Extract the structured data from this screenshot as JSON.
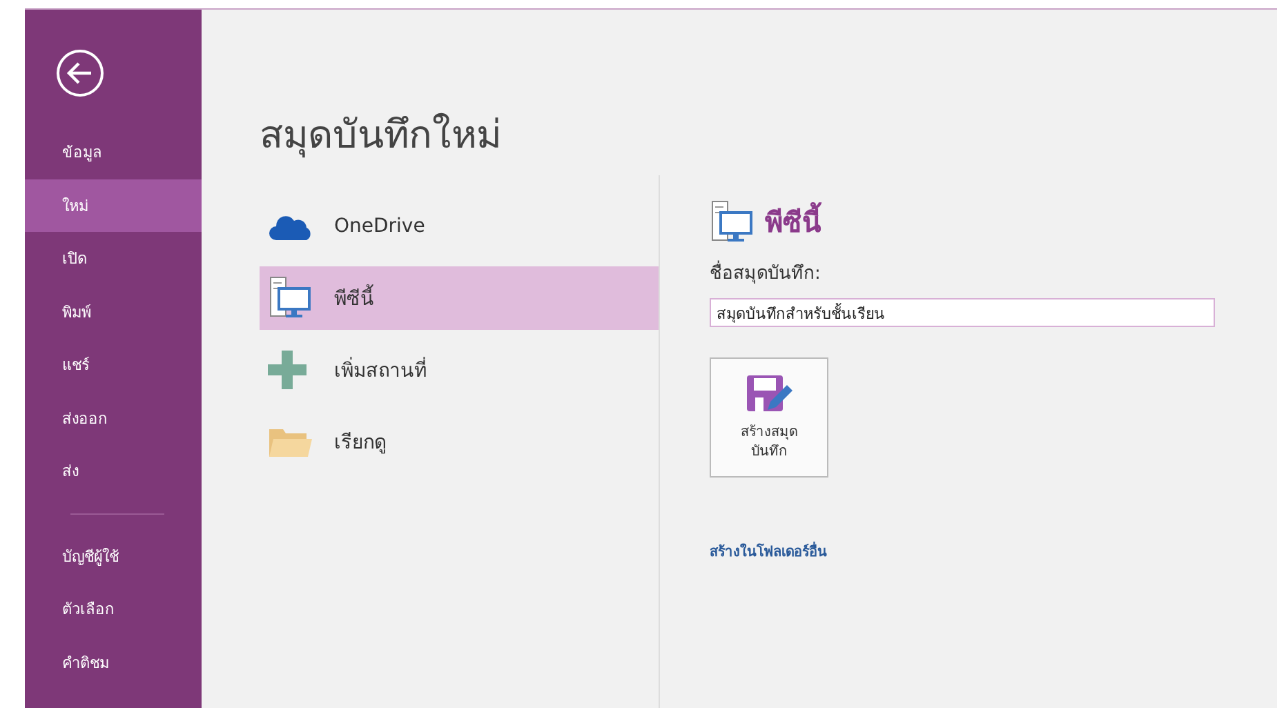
{
  "sidebar": {
    "items": [
      {
        "label": "ข้อมูล",
        "selected": false
      },
      {
        "label": "ใหม่",
        "selected": true
      },
      {
        "label": "เปิด",
        "selected": false
      },
      {
        "label": "พิมพ์",
        "selected": false
      },
      {
        "label": "แชร์",
        "selected": false
      },
      {
        "label": "ส่งออก",
        "selected": false
      },
      {
        "label": "ส่ง",
        "selected": false
      }
    ],
    "footer_items": [
      {
        "label": "บัญชีผู้ใช้",
        "selected": false
      },
      {
        "label": "ตัวเลือก",
        "selected": false
      },
      {
        "label": "คำติชม",
        "selected": false
      }
    ]
  },
  "page_title": "สมุดบันทึกใหม่",
  "locations": [
    {
      "label": "OneDrive",
      "kind": "cloud",
      "selected": false
    },
    {
      "label": "พีซีนี้",
      "kind": "pc",
      "selected": true
    },
    {
      "label": "เพิ่มสถานที่",
      "kind": "add",
      "selected": false
    },
    {
      "label": "เรียกดู",
      "kind": "folder",
      "selected": false
    }
  ],
  "detail": {
    "title": "พีซีนี้",
    "name_label": "ชื่อสมุดบันทึก:",
    "name_value": "สมุดบันทึกสำหรับชั้นเรียน",
    "create_button": [
      "สร้างสมุด",
      "บันทึก"
    ],
    "other_folder_link": "สร้างในโฟลเดอร์อื่น"
  }
}
